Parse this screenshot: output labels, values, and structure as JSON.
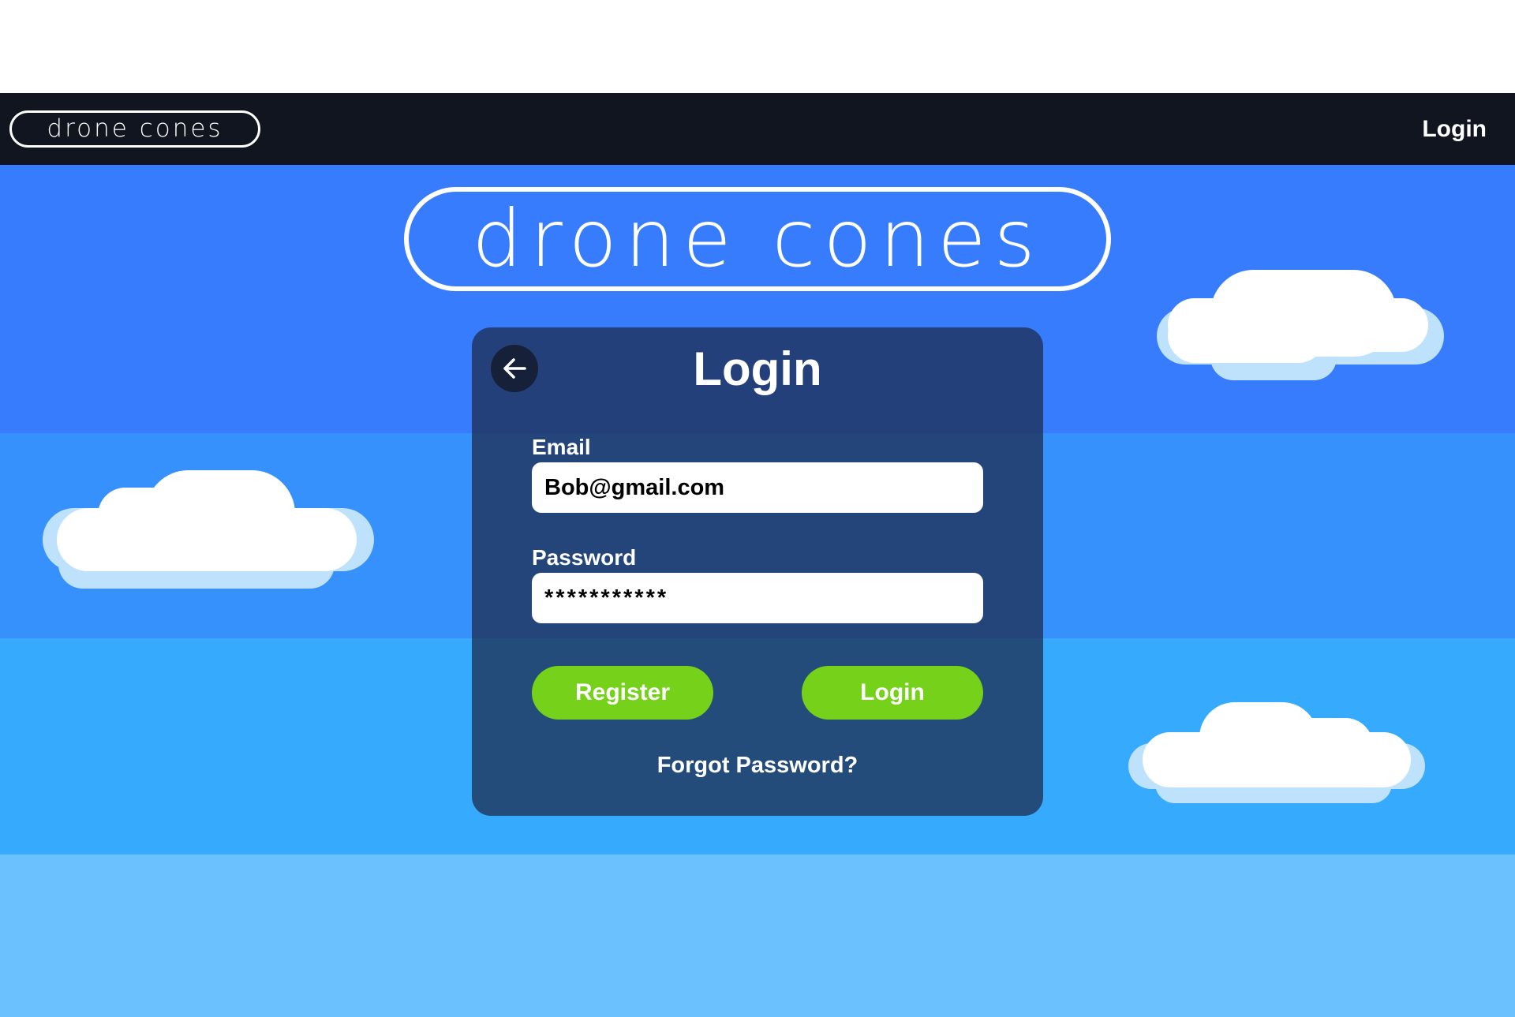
{
  "navbar": {
    "logo_text": "drone cones",
    "login_link": "Login"
  },
  "hero": {
    "logo_text": "drone cones"
  },
  "login_panel": {
    "title": "Login",
    "back_icon": "arrow-left-icon",
    "email_label": "Email",
    "email_value": "Bob@gmail.com",
    "password_label": "Password",
    "password_value": "***********",
    "register_button": "Register",
    "login_button": "Login",
    "forgot_password": "Forgot Password?"
  },
  "colors": {
    "navbar": "#111520",
    "sky_band_1": "#377cfd",
    "sky_band_2": "#3791fd",
    "sky_band_3": "#36aafd",
    "sky_band_4": "#6ac1fe",
    "button_green": "#76d11b",
    "cloud_shadow": "#bfe2fc",
    "cloud": "#ffffff"
  }
}
